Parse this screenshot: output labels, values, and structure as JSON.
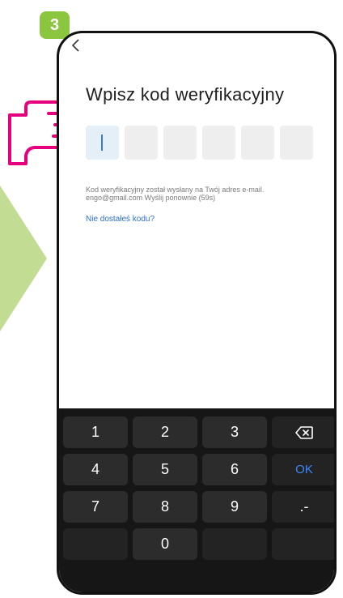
{
  "step": {
    "number": "3"
  },
  "screen": {
    "title": "Wpisz kod weryfikacyjny",
    "code_boxes": 6,
    "info_line1": "Kod weryfikacyjny został wysłany na Twój adres e-mail.",
    "info_line2": "engo@gmail.com Wyślij ponownie (59s)",
    "resend_link": "Nie dostałeś kodu?"
  },
  "keyboard": {
    "keys": [
      "1",
      "2",
      "3",
      "⌫",
      "4",
      "5",
      "6",
      "OK",
      "7",
      "8",
      "9",
      ".-",
      "",
      "0",
      "",
      ""
    ]
  },
  "colors": {
    "accent_green": "#8cc63f",
    "hand_pink": "#e6007e",
    "link_blue": "#2c6fd1",
    "ok_blue": "#3a86ff",
    "keyboard_bg": "#161616"
  }
}
